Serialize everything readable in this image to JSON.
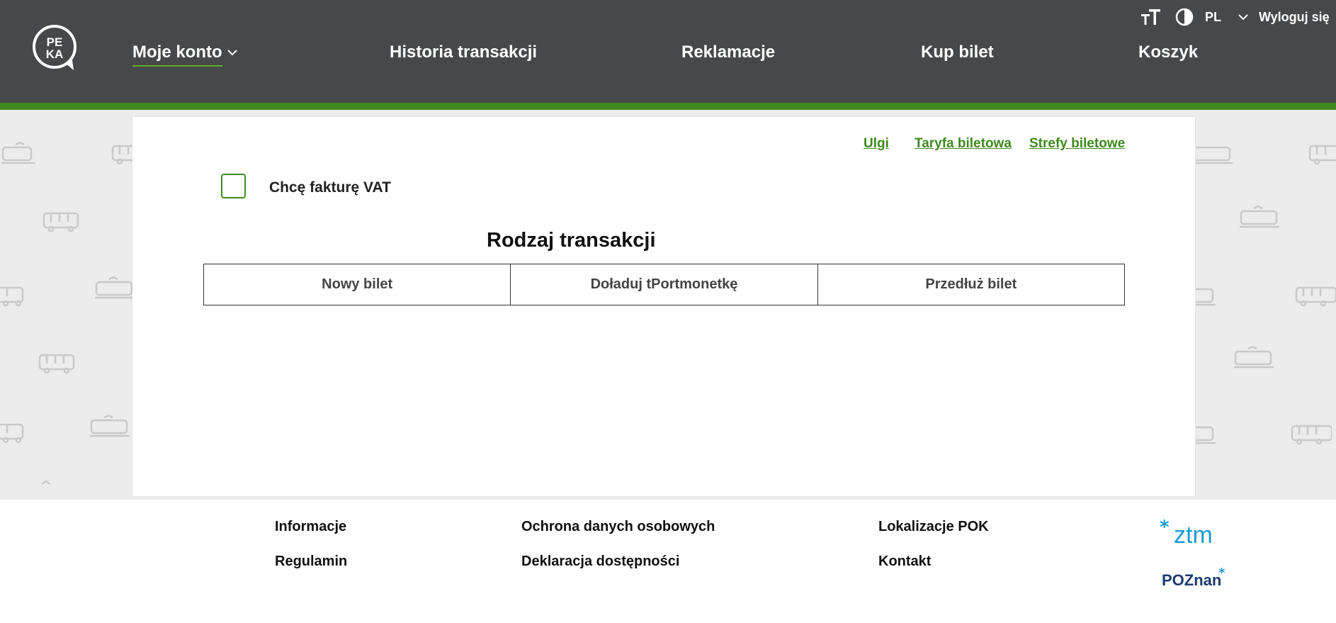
{
  "header": {
    "logo_text_top": "PE",
    "logo_text_bottom": "KA",
    "nav": [
      {
        "label": "Moje konto"
      },
      {
        "label": "Historia transakcji"
      },
      {
        "label": "Reklamacje"
      },
      {
        "label": "Kup bilet"
      },
      {
        "label": "Koszyk"
      }
    ],
    "utility": {
      "text_size_icon": "text-size-icon",
      "contrast_icon": "contrast-icon",
      "language": "PL",
      "logout": "Wyloguj się"
    }
  },
  "main": {
    "links": [
      "Ulgi",
      "Taryfa biletowa",
      "Strefy biletowe"
    ],
    "invoice_checkbox_label": "Chcę fakturę VAT",
    "invoice_checked": false,
    "section_title": "Rodzaj transakcji",
    "tabs": [
      "Nowy bilet",
      "Doładuj tPortmonetkę",
      "Przedłuż bilet"
    ]
  },
  "footer": {
    "col1": [
      "Informacje",
      "Regulamin"
    ],
    "col2": [
      "Ochrona danych osobowych",
      "Deklaracja dostępności"
    ],
    "col3": [
      "Lokalizacje POK",
      "Kontakt"
    ],
    "ztm_logo_text": "ztm",
    "poznan_logo_text": "POZnan"
  },
  "colors": {
    "header_bg": "#474849",
    "accent_green": "#3f8a1f",
    "ztm_blue": "#1a9ad6",
    "poznan_navy": "#1c3a70"
  }
}
